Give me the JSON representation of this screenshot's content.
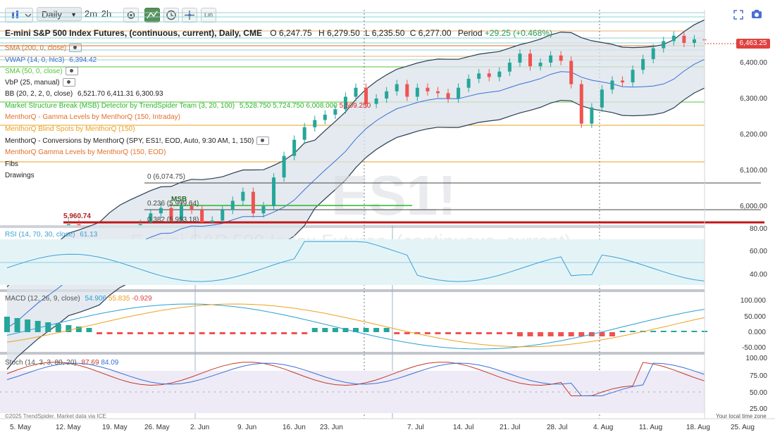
{
  "toolbar": {
    "interval": "Daily",
    "quick_intervals": [
      "2m",
      "2h"
    ],
    "lin_label": "Lin"
  },
  "header": {
    "symbol": "E-mini S&P 500 Index Futures, (continuous, current), Daily, CME",
    "o_label": "O",
    "o_value": "6,247.75",
    "h_label": "H",
    "h_value": "6,279.50",
    "l_label": "L",
    "l_value": "6,235.50",
    "c_label": "C",
    "c_value": "6,277.00",
    "period_label": "Period",
    "period_value": "+29.25 (+0.468%)"
  },
  "indicators": [
    {
      "text": "SMA (200, 0, close)",
      "color": "#e0702b"
    },
    {
      "text": "VWAP (14, 0, hlc3)",
      "color": "#3a6fd8",
      "value": "6,394.42"
    },
    {
      "text": "SMA (50, 0, close)",
      "color": "#58c23a"
    },
    {
      "text": "VbP (25, manual)",
      "color": "#333333"
    },
    {
      "text": "BB (20, 2, 2, 0, close)",
      "color": "#333333",
      "value": "6,521.70 6,411.31 6,300.93"
    },
    {
      "text": "Market Structure Break (MSB) Detector by TrendSpider Team (3, 20, 100)",
      "color": "#2bb52b",
      "value": "5,528.750 5,724.750 6,008.000",
      "value2": "5,509.250"
    },
    {
      "text": "MenthorQ - Gamma Levels by MenthorQ (150, Intraday)",
      "color": "#e0702b"
    },
    {
      "text": "MenthorQ Blind Spots by MenthorQ (150)",
      "color": "#e8a020"
    },
    {
      "text": "MenthorQ - Conversions by MenthorQ (SPY, ES1!, EOD, Auto, 9:30 AM, 1, 150)",
      "color": "#333333"
    },
    {
      "text": "MenthorQ Gamma Levels by MenthorQ (150, EOD)",
      "color": "#e0702b"
    },
    {
      "text": "Fibs",
      "color": "#333333"
    },
    {
      "text": "Drawings",
      "color": "#333333"
    }
  ],
  "fib_labels": [
    "0 (6,074.75)",
    "0.236 (5,999.64)",
    "0.382 (5,953.18)"
  ],
  "msb_label": "MSB",
  "level_label": "5,960.74",
  "watermark": "ES1!",
  "watermark_sub": "E-mini S&P 500 Index Futures, (continuous, current)",
  "last_price": "6,463.25",
  "price_axis": [
    "6,400.00",
    "6,300.00",
    "6,200.00",
    "6,100.00",
    "6,000.00"
  ],
  "rsi": {
    "label": "RSI (14, 70, 30, close)",
    "value": "61.13",
    "axis": [
      "80.00",
      "60.00",
      "40.00"
    ]
  },
  "macd": {
    "label": "MACD (12, 26, 9, close)",
    "v1": "54.906",
    "v2": "55.835",
    "v3": "-0.929",
    "axis": [
      "100.000",
      "50.000",
      "0.000",
      "-50.000"
    ]
  },
  "stoch": {
    "label": "Stoch (14, 3, 3, 80, 20)",
    "v1": "87.69",
    "v2": "84.09",
    "axis": [
      "100.00",
      "75.00",
      "50.00",
      "25.00"
    ]
  },
  "dates": [
    "5. May",
    "12. May",
    "19. May",
    "26. May",
    "2. Jun",
    "9. Jun",
    "16. Jun",
    "23. Jun",
    "7. Jul",
    "14. Jul",
    "21. Jul",
    "28. Jul",
    "4. Aug",
    "11. Aug",
    "18. Aug",
    "25. Aug"
  ],
  "copyright": "©2025 TrendSpider. Market data via ICE",
  "timezone": "Your local time zone",
  "colors": {
    "up": "#26a69a",
    "down": "#ef5350",
    "bb": "#2b3f55",
    "rsi": "#3aa0d8",
    "macd": "#2a9fd6",
    "signal": "#f0a020"
  },
  "chart_data": {
    "type": "line",
    "note_series": "daily close, ES1! (approx.)",
    "closes": [
      5660,
      5730,
      5770,
      5820,
      5850,
      5890,
      5950,
      5880,
      5910,
      5940,
      5930,
      5940,
      5915,
      5950,
      5980,
      5995,
      5960,
      6000,
      5990,
      5930,
      5960,
      5990,
      6015,
      6040,
      5980,
      6000,
      6080,
      6140,
      6185,
      6220,
      6240,
      6255,
      6270,
      6305,
      6330,
      6285,
      6300,
      6320,
      6340,
      6305,
      6330,
      6320,
      6315,
      6300,
      6330,
      6355,
      6370,
      6360,
      6375,
      6400,
      6425,
      6390,
      6400,
      6420,
      6405,
      6340,
      6230,
      6275,
      6325,
      6350,
      6345,
      6380,
      6410,
      6440,
      6460,
      6475,
      6455,
      6465,
      6463
    ]
  }
}
